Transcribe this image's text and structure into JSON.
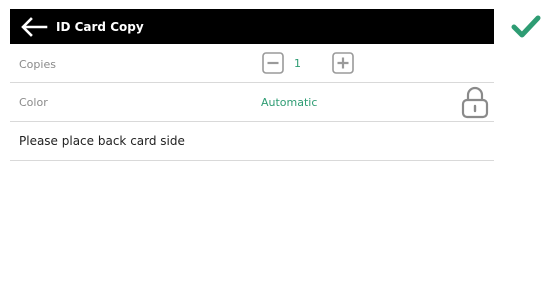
{
  "header": {
    "title": "ID Card Copy",
    "back_icon": "arrow-left-icon",
    "confirm_icon": "checkmark-icon"
  },
  "copies": {
    "label": "Copies",
    "value": "1",
    "minus_icon": "minus-icon",
    "plus_icon": "plus-icon"
  },
  "color": {
    "label": "Color",
    "value": "Automatic",
    "lock_icon": "lock-icon"
  },
  "message": "Please place back card side",
  "colors": {
    "accent": "#2e9c73",
    "header_bg": "#000000",
    "divider": "#d9d9d9"
  }
}
